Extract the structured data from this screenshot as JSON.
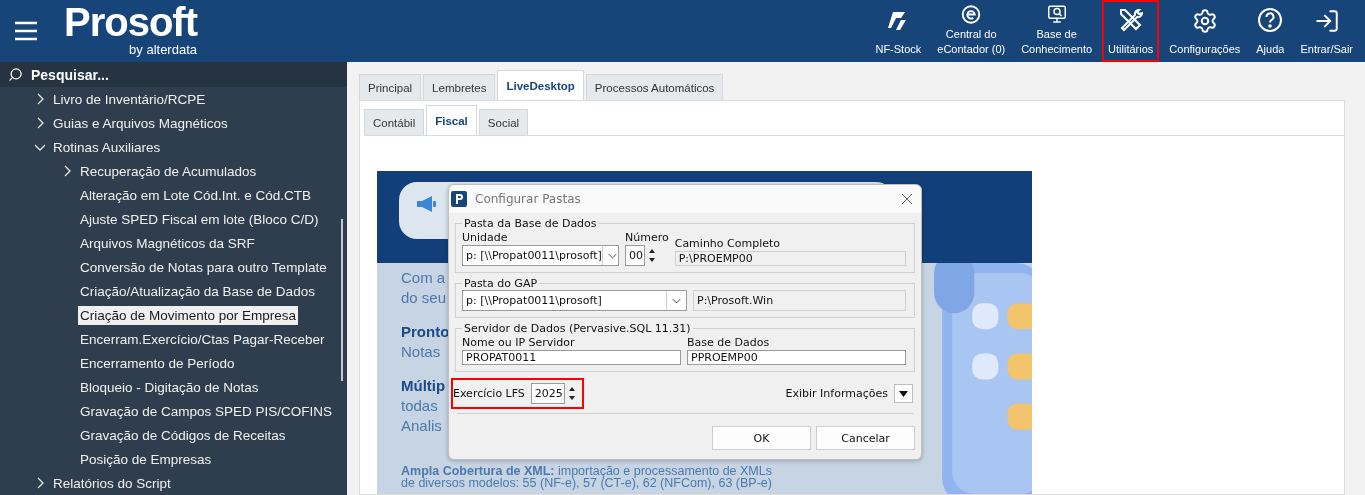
{
  "header": {
    "logo": {
      "name": "Prosoft",
      "tagline": "by alterdata"
    },
    "toolbar": [
      {
        "kind": "nfstock",
        "lines": [
          "NF-Stock"
        ],
        "highlighted": false
      },
      {
        "kind": "econtador",
        "lines": [
          "Central do",
          "eContador (0)"
        ],
        "highlighted": false
      },
      {
        "kind": "knowledge",
        "lines": [
          "Base de",
          "Conhecimento"
        ],
        "highlighted": false
      },
      {
        "kind": "tools",
        "lines": [
          "Utilitários"
        ],
        "highlighted": true
      },
      {
        "kind": "settings",
        "lines": [
          "Configurações"
        ],
        "highlighted": false
      },
      {
        "kind": "help",
        "lines": [
          "Ajuda"
        ],
        "highlighted": false
      },
      {
        "kind": "login",
        "lines": [
          "Entrar/Sair"
        ],
        "highlighted": false
      }
    ]
  },
  "sidebar": {
    "search": {
      "placeholder": "Pesquisar..."
    },
    "items": [
      {
        "label": "Livro de Inventário/RCPE",
        "expanded": false,
        "selected": false
      },
      {
        "label": "Guias e Arquivos Magnéticos",
        "expanded": false,
        "selected": false
      },
      {
        "label": "Rotinas Auxiliares",
        "expanded": true,
        "selected": false,
        "children": [
          {
            "label": "Recuperação de Acumulados",
            "expanded": false,
            "selected": false
          },
          {
            "label": "Alteração em Lote Cód.Int. e Cód.CTB",
            "selected": false
          },
          {
            "label": "Ajuste SPED Fiscal em lote (Bloco C/D)",
            "selected": false
          },
          {
            "label": "Arquivos Magnéticos da SRF",
            "selected": false
          },
          {
            "label": "Conversão de Notas para outro Template",
            "selected": false
          },
          {
            "label": "Criação/Atualização da Base de Dados",
            "selected": false
          },
          {
            "label": "Criação de Movimento por Empresa",
            "selected": true
          },
          {
            "label": "Encerram.Exercício/Ctas Pagar-Receber",
            "selected": false
          },
          {
            "label": "Encerramento de Período",
            "selected": false
          },
          {
            "label": "Bloqueio - Digitação de Notas",
            "selected": false
          },
          {
            "label": "Gravação de Campos SPED PIS/COFINS",
            "selected": false
          },
          {
            "label": "Gravação de Códigos de Receitas",
            "selected": false
          },
          {
            "label": "Posição de Empresas",
            "selected": false
          }
        ]
      },
      {
        "label": "Relatórios do Script",
        "expanded": false,
        "selected": false
      }
    ]
  },
  "tabs": [
    {
      "label": "Principal",
      "selected": false
    },
    {
      "label": "Lembretes",
      "selected": false
    },
    {
      "label": "LiveDesktop",
      "selected": true
    },
    {
      "label": "Processos Automáticos",
      "selected": false
    }
  ],
  "subtabs": [
    {
      "label": "Contábil",
      "selected": false
    },
    {
      "label": "Fiscal",
      "selected": true
    },
    {
      "label": "Social",
      "selected": false
    }
  ],
  "banner": {
    "paragraphs": [
      {
        "lines": [
          {
            "text": "Com a",
            "bold": false
          },
          {
            "text": "do seu",
            "bold": false
          }
        ]
      },
      {
        "lines": [
          {
            "text": "Pronto",
            "bold": true
          },
          {
            "text": "Notas",
            "bold": false
          }
        ]
      },
      {
        "lines": [
          {
            "text": "Múltip",
            "bold": true
          },
          {
            "text": "todas",
            "bold": false
          },
          {
            "text": "Analis",
            "bold": false
          }
        ]
      },
      {
        "lines": [
          {
            "text": "**Ampla Cobertura de XML:** importação e processamento de XMLs",
            "bold": false
          },
          {
            "text": "de diversos modelos: 55 (NF-e), 57 (CT-e), 62 (NFCom), 63 (BP-e)",
            "bold": false
          }
        ]
      }
    ]
  },
  "dialog": {
    "title": "Configurar Pastas",
    "database": {
      "legend": "Pasta da Base de Dados",
      "unit_label": "Unidade",
      "unit_value": "p: [\\\\Propat0011\\prosoft]",
      "number_label": "Número",
      "number_value": "00",
      "path_label": "Caminho Completo",
      "path_value": "P:\\PROEMP00"
    },
    "gap": {
      "legend": "Pasta do GAP",
      "unit_value": "p: [\\\\Propat0011\\prosoft]",
      "path_value": "P:\\Prosoft.Win"
    },
    "server": {
      "legend": "Servidor de Dados (Pervasive.SQL 11.31)",
      "host_label": "Nome ou IP Servidor",
      "host_value": "PROPAT0011",
      "db_label": "Base de Dados",
      "db_value": "PPROEMP00"
    },
    "exercise": {
      "label": "Exercício LFS",
      "value": "2025",
      "highlighted": true
    },
    "info_label": "Exibir Informações",
    "buttons": [
      {
        "label": "OK"
      },
      {
        "label": "Cancelar"
      }
    ]
  }
}
